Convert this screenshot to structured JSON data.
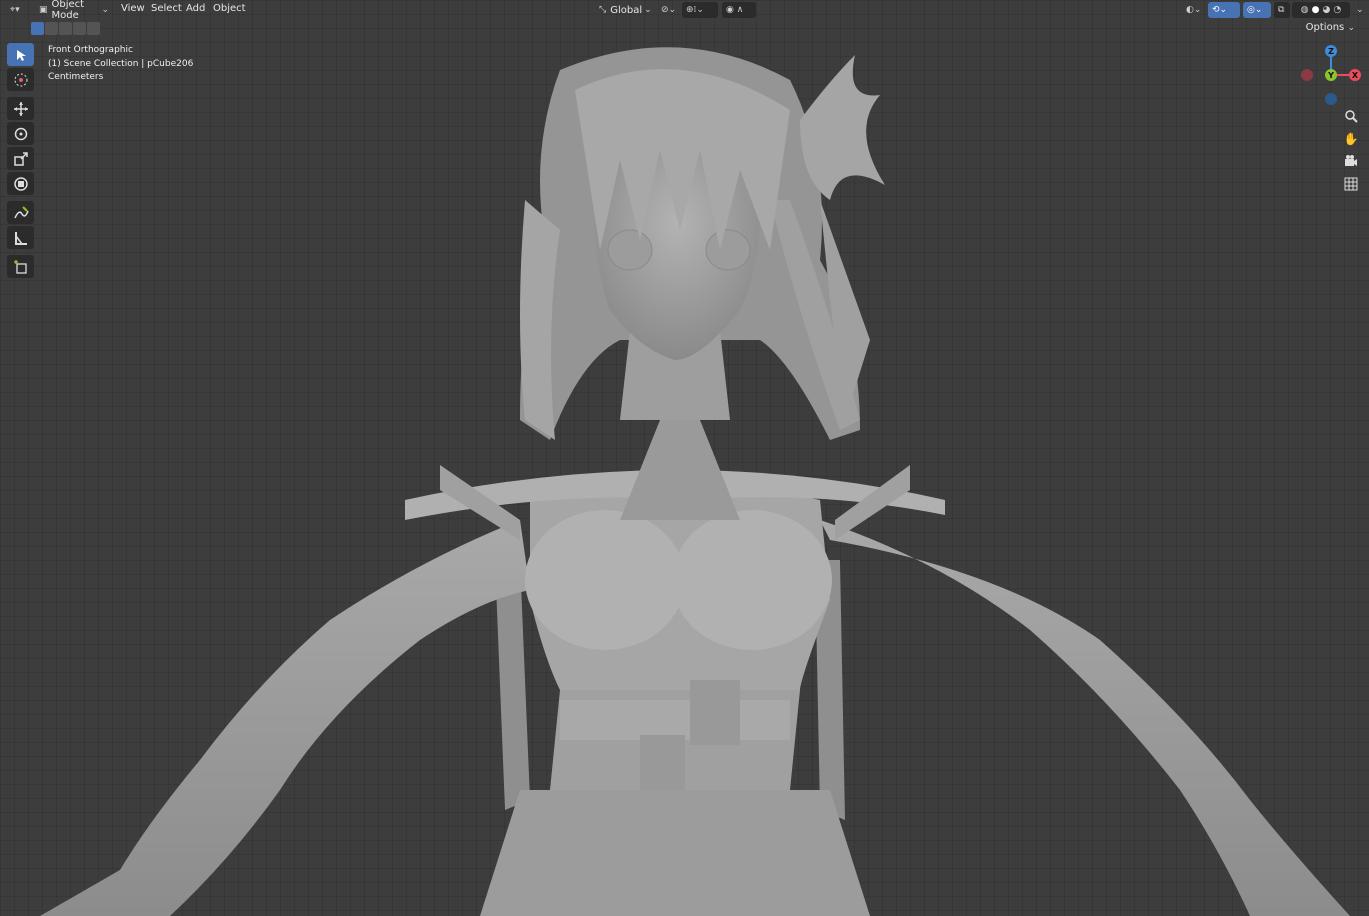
{
  "header": {
    "mode_label": "Object Mode",
    "menus": [
      "View",
      "Select",
      "Add",
      "Object"
    ],
    "orientation_label": "Global",
    "options_label": "Options"
  },
  "overlay": {
    "view_name": "Front Orthographic",
    "collection": "(1) Scene Collection | pCube206",
    "units": "Centimeters"
  },
  "gizmo": {
    "z_label": "Z",
    "y_label": "Y",
    "x_label": "X",
    "colors": {
      "x": "#e84d5c",
      "y": "#8bc42e",
      "z": "#3f8cdb"
    }
  },
  "toolbar": {
    "tools": [
      "select-box-icon",
      "cursor-icon",
      "move-icon",
      "rotate-icon",
      "scale-icon",
      "transform-icon",
      "annotate-icon",
      "measure-icon",
      "add-cube-icon"
    ],
    "active_tool": "select-box-icon"
  },
  "nav": {
    "buttons": [
      "zoom-icon",
      "hand-pan-icon",
      "camera-icon",
      "grid-icon"
    ]
  },
  "theme": {
    "accent": "#4772b3",
    "viewport_bg": "#3d3d3d"
  }
}
